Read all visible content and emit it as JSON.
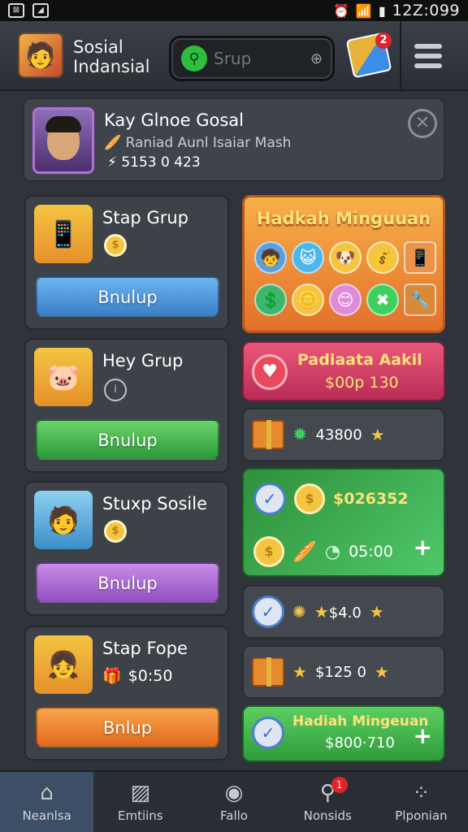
{
  "status_bar": {
    "time": "12Z:099"
  },
  "header": {
    "title_line1": "Sosial",
    "title_line2": "Indansial",
    "search_placeholder": "Srup",
    "games_badge": "2"
  },
  "profile": {
    "name": "Kay Glnoe Gosal",
    "subtitle": "Raniad Aunl Isaiar Mash",
    "points": "5153 0 423"
  },
  "groups": [
    {
      "title": "Stap Grup",
      "button": "Bnulup",
      "coin": "$"
    },
    {
      "title": "Hey Grup",
      "button": "Bnulup",
      "info": "i"
    },
    {
      "title": "Stuxp Sosile",
      "button": "Bnulup",
      "coin": "$"
    },
    {
      "title": "Stap Fope",
      "button": "Bnlup",
      "price": "$0:50"
    }
  ],
  "reward_big": {
    "title": "Hadkah Minguuan"
  },
  "promo_pink": {
    "title": "Padiaata Aakil",
    "price": "$00p 130"
  },
  "rows": {
    "row1": "43800",
    "green_top": "$026352",
    "green_bottom": "05:00",
    "row2": "$4.0",
    "row3": "$125 0"
  },
  "green_final": {
    "title": "Hadiah Mingeuan",
    "price": "$800·710"
  },
  "nav": [
    {
      "label": "Neanlsa"
    },
    {
      "label": "Emtiins"
    },
    {
      "label": "Fallo"
    },
    {
      "label": "Nonsids",
      "badge": "1"
    },
    {
      "label": "Plponian"
    }
  ],
  "colors": {
    "accent_green": "#2fbf3e",
    "accent_orange": "#f7b04a",
    "accent_pink": "#e9587a",
    "active_nav": "#3c4f66"
  }
}
